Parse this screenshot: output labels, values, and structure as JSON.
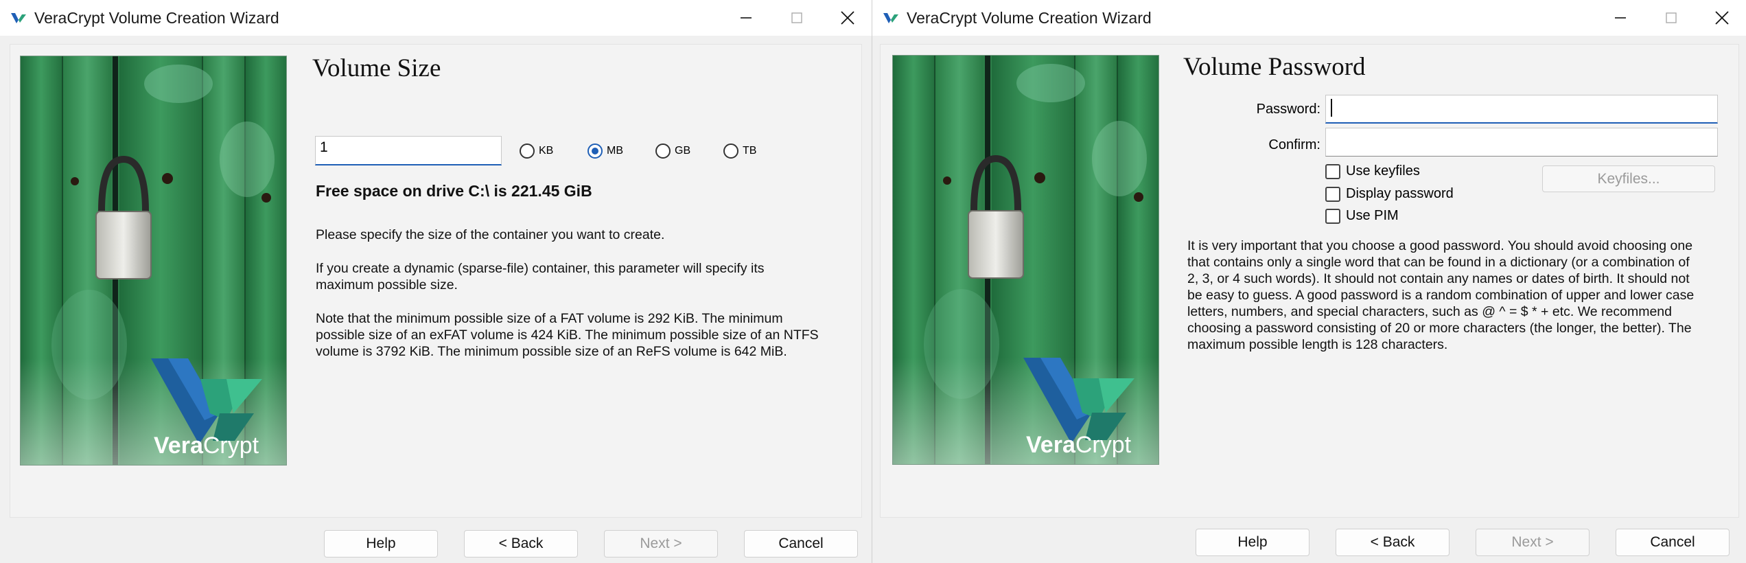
{
  "window_a": {
    "title": "VeraCrypt Volume Creation Wizard",
    "heading": "Volume Size",
    "size_value": "1",
    "units": [
      "KB",
      "MB",
      "GB",
      "TB"
    ],
    "selected_unit": "MB",
    "free_space": "Free space on drive C:\\ is 221.45 GiB",
    "para1": "Please specify the size of the container you want to create.",
    "para2_l1": "If you create a dynamic (sparse-file) container, this parameter will specify its",
    "para2_l2": "maximum possible size.",
    "para3_l1": "Note that the minimum possible size of a FAT volume is 292 KiB. The minimum",
    "para3_l2": "possible size of an exFAT volume is 424 KiB. The minimum possible size of an NTFS",
    "para3_l3": "volume is 3792 KiB. The minimum possible size of an ReFS volume is 642 MiB.",
    "logo_text_a": "Vera",
    "logo_text_b": "Crypt",
    "buttons": {
      "help": "Help",
      "back": "< Back",
      "next": "Next >",
      "cancel": "Cancel"
    }
  },
  "window_b": {
    "title": "VeraCrypt Volume Creation Wizard",
    "heading": "Volume Password",
    "password_label": "Password:",
    "password_value": "",
    "confirm_label": "Confirm:",
    "confirm_value": "",
    "use_keyfiles": "Use keyfiles",
    "display_password": "Display password",
    "use_pim": "Use PIM",
    "keyfiles_button": "Keyfiles...",
    "info_l1": "It is very important that you choose a good password. You should avoid choosing one",
    "info_l2": "that contains only a single word that can be found in a dictionary (or a combination of",
    "info_l3": "2, 3, or 4 such words). It should not contain any names or dates of birth. It should not",
    "info_l4": "be easy to guess. A good password is a random combination of upper and lower case",
    "info_l5": "letters, numbers, and special characters, such as @ ^ = $ * + etc. We recommend",
    "info_l6": "choosing a password consisting of 20 or more characters (the longer, the better). The",
    "info_l7": "maximum possible length is 128 characters.",
    "logo_text_a": "Vera",
    "logo_text_b": "Crypt",
    "buttons": {
      "help": "Help",
      "back": "< Back",
      "next": "Next >",
      "cancel": "Cancel"
    }
  },
  "colors": {
    "accent": "#1f5fb6",
    "door_green": "#2f8a4e",
    "window_bg": "#f0f0f0"
  },
  "icons": [
    "veracrypt-app-icon",
    "minimize-icon",
    "maximize-icon",
    "close-icon",
    "padlock-icon",
    "veracrypt-logo-icon"
  ]
}
